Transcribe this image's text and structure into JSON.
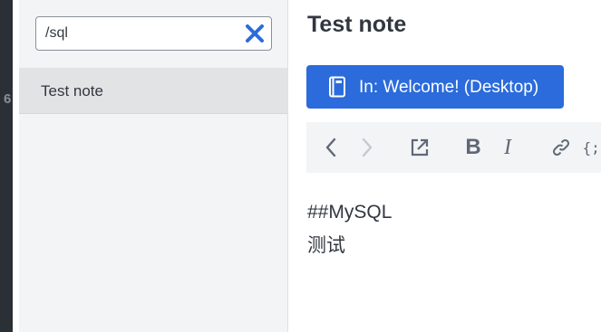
{
  "gutter": {
    "line_number": "6"
  },
  "note_list": {
    "search": {
      "value": "/sql"
    },
    "items": [
      {
        "title": "Test note",
        "selected": true
      }
    ]
  },
  "editor": {
    "title": "Test note",
    "notebook_button": {
      "label": "In: Welcome! (Desktop)",
      "icon": "notebook-icon"
    },
    "toolbar": {
      "buttons": [
        {
          "name": "back",
          "icon": "chevron-left-icon",
          "enabled": true
        },
        {
          "name": "forward",
          "icon": "chevron-right-icon",
          "enabled": false
        },
        {
          "name": "open-external",
          "icon": "external-link-icon",
          "enabled": true
        },
        {
          "name": "bold",
          "label": "B"
        },
        {
          "name": "italic",
          "label": "I"
        },
        {
          "name": "link",
          "icon": "link-icon"
        },
        {
          "name": "code",
          "label": "{;}"
        }
      ]
    },
    "body_lines": [
      "##MySQL",
      "测试"
    ]
  },
  "colors": {
    "accent": "#2b6bdb",
    "sidebar_strip": "#2b2f36",
    "list_bg": "#f3f4f6",
    "selected_item_bg": "#e2e3e5",
    "text": "#32373f"
  }
}
